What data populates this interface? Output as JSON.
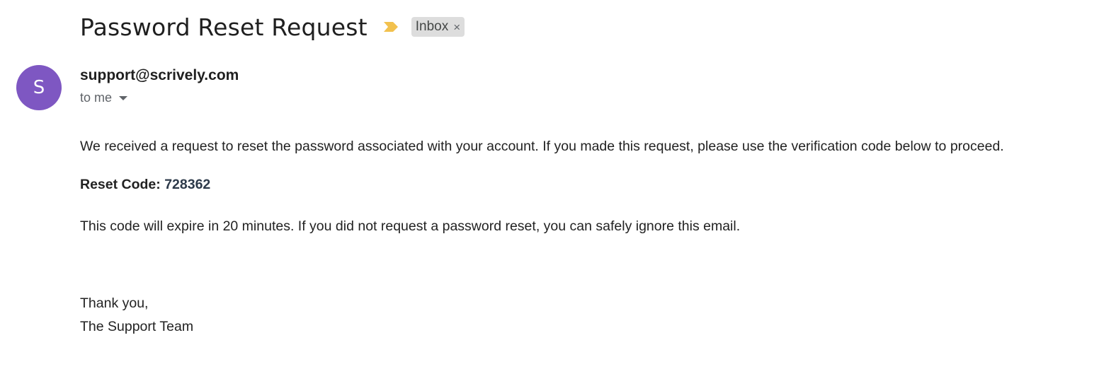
{
  "email": {
    "subject": "Password Reset Request",
    "label": "Inbox",
    "label_remove_glyph": "×",
    "importance_icon": "importance-marker-icon",
    "importance_color": "#f2c14e",
    "sender": {
      "avatar_initial": "S",
      "avatar_color": "#7e57c2",
      "address": "support@scrively.com",
      "recipient_text": "to me"
    },
    "body": {
      "intro": "We received a request to reset the password associated with your account. If you made this request, please use the verification code below to proceed.",
      "code_label": "Reset Code:",
      "code_value": "728362",
      "expiry_note": "This code will expire in 20 minutes. If you did not request a password reset, you can safely ignore this email.",
      "closing": "Thank you,",
      "signature": "The Support Team"
    }
  }
}
